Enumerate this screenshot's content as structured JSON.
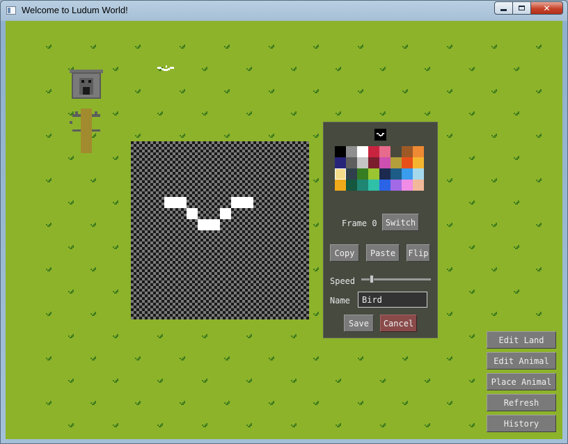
{
  "window": {
    "title": "Welcome to Ludum World!",
    "buttons": {
      "minimize": "minimize",
      "maximize": "maximize",
      "close": "✕"
    }
  },
  "colors": {
    "grass": "#8db32a",
    "tuft": "#3f7d1d",
    "panel": "#464a3f",
    "button": "#7a7a7a",
    "cancel_button": "#8a4a4a"
  },
  "world": {
    "objects": [
      {
        "name": "castle",
        "icon": "castle-icon"
      },
      {
        "name": "tree",
        "icon": "tree-icon"
      },
      {
        "name": "bird",
        "icon": "bird-icon"
      }
    ]
  },
  "editor": {
    "palette": [
      "#000000",
      "#8f8f8f",
      "#ffffff",
      "#c8243f",
      "#e66b8c",
      "#4a4a3c",
      "#9d5a27",
      "#ee8a33",
      "#27257a",
      "#5e5e5e",
      "#c5c5c5",
      "#7a1e2e",
      "#cd4fb0",
      "#b49f3b",
      "#e8501a",
      "#f6b52f",
      "#f3dc8a",
      "#2f3f4c",
      "#377d21",
      "#9bc530",
      "#1c2a4f",
      "#1d5c86",
      "#3a9cec",
      "#a6d8ec",
      "#f0aa1a",
      "#16573f",
      "#1f8673",
      "#2fc0a8",
      "#2a63e6",
      "#a26ae6",
      "#f08ce6",
      "#f2b89a"
    ],
    "selected_color": "#f3dc8a",
    "frame_label": "Frame 0",
    "switch_label": "Switch",
    "copy_label": "Copy",
    "paste_label": "Paste",
    "flip_label": "Flip",
    "speed_label": "Speed",
    "speed_value": 0.15,
    "name_label": "Name",
    "name_value": "Bird",
    "save_label": "Save",
    "cancel_label": "Cancel"
  },
  "sidebar": {
    "edit_land": "Edit Land",
    "edit_animal": "Edit Animal",
    "place_animal": "Place Animal",
    "refresh": "Refresh",
    "history": "History"
  }
}
